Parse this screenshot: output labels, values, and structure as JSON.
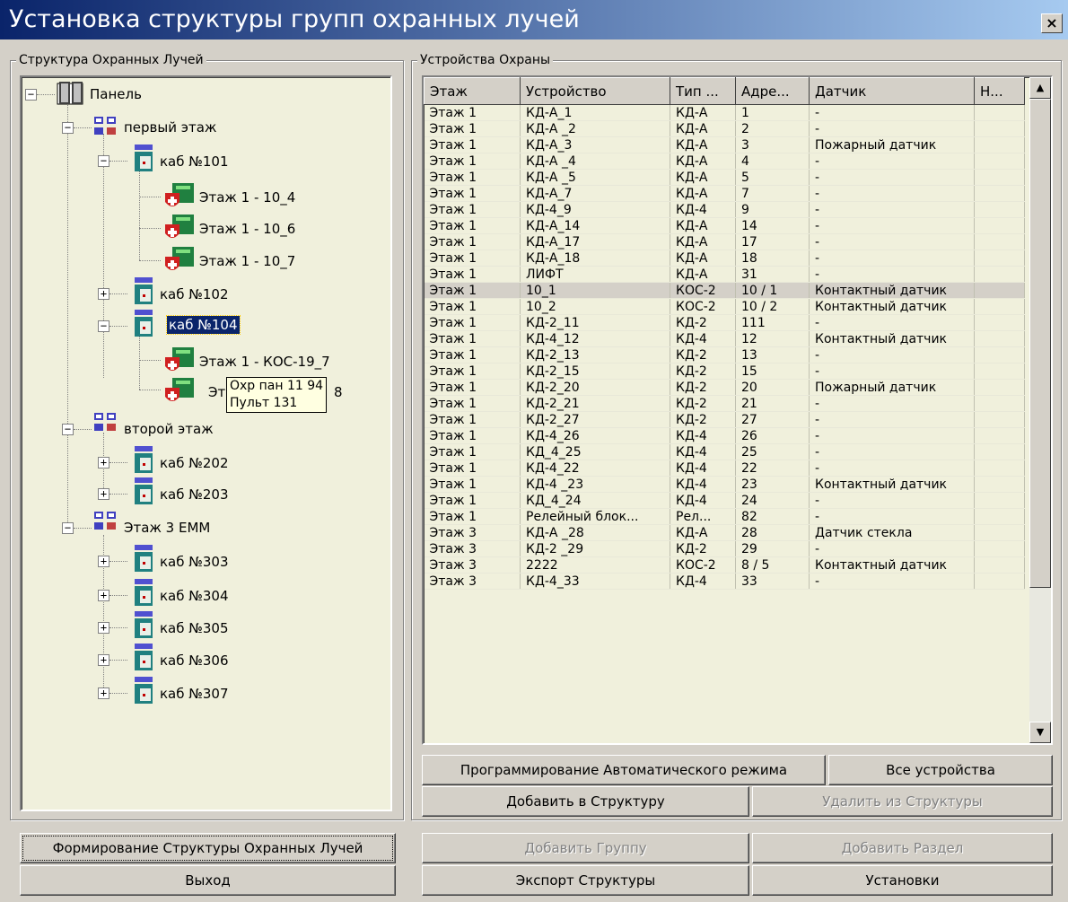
{
  "window": {
    "title": "Установка структуры групп охранных лучей",
    "close": "×"
  },
  "left_group": {
    "label": "Структура Охранных Лучей"
  },
  "right_group": {
    "label": "Устройства Охраны"
  },
  "tree": {
    "root": "Панель",
    "floor1": "первый этаж",
    "room101": "каб №101",
    "z1": "Этаж 1 - 10_4",
    "z2": "Этаж 1 - 10_6",
    "z3": "Этаж 1 - 10_7",
    "room102": "каб №102",
    "room104": "каб №104",
    "z4": "Этаж 1 - КОС-19_7",
    "z5a": "Эт",
    "z5b": "8",
    "floor2": "второй этаж",
    "room202": "каб №202",
    "room203": "каб №203",
    "floor3": "Этаж 3  ЕММ",
    "room303": "каб №303",
    "room304": "каб №304",
    "room305": "каб №305",
    "room306": "каб №306",
    "room307": "каб №307"
  },
  "tooltip": {
    "line1": "Охр пан 11 94",
    "line2": "Пульт 131"
  },
  "table": {
    "headers": [
      "Этаж",
      "Устройство",
      "Тип ...",
      "Адре...",
      "Датчик",
      "Н..."
    ],
    "rows": [
      [
        "Этаж 1",
        "КД-А_1",
        "КД-А",
        "1",
        "-",
        ""
      ],
      [
        "Этаж 1",
        "КД-А _2",
        "КД-А",
        "2",
        "-",
        ""
      ],
      [
        "Этаж 1",
        "КД-А_3",
        "КД-А",
        "3",
        "Пожарный датчик",
        ""
      ],
      [
        "Этаж 1",
        "КД-А _4",
        "КД-А",
        "4",
        "-",
        ""
      ],
      [
        "Этаж 1",
        "КД-А _5",
        "КД-А",
        "5",
        "-",
        ""
      ],
      [
        "Этаж 1",
        "КД-А_7",
        "КД-А",
        "7",
        "-",
        ""
      ],
      [
        "Этаж 1",
        "КД-4_9",
        "КД-4",
        "9",
        "-",
        ""
      ],
      [
        "Этаж 1",
        "КД-А_14",
        "КД-А",
        "14",
        "-",
        ""
      ],
      [
        "Этаж 1",
        "КД-А_17",
        "КД-А",
        "17",
        "-",
        ""
      ],
      [
        "Этаж 1",
        "КД-А_18",
        "КД-А",
        "18",
        "-",
        ""
      ],
      [
        "Этаж 1",
        "ЛИФТ",
        "КД-А",
        "31",
        "-",
        ""
      ],
      [
        "Этаж 1",
        "10_1",
        "КОС-2",
        "10 / 1",
        "Контактный датчик",
        ""
      ],
      [
        "Этаж 1",
        "10_2",
        "КОС-2",
        "10 / 2",
        "Контактный датчик",
        ""
      ],
      [
        "Этаж 1",
        "КД-2_11",
        "КД-2",
        "111",
        "-",
        ""
      ],
      [
        "Этаж 1",
        "КД-4_12",
        "КД-4",
        "12",
        "Контактный датчик",
        ""
      ],
      [
        "Этаж 1",
        "КД-2_13",
        "КД-2",
        "13",
        "-",
        ""
      ],
      [
        "Этаж 1",
        "КД-2_15",
        "КД-2",
        "15",
        "-",
        ""
      ],
      [
        "Этаж 1",
        "КД-2_20",
        "КД-2",
        "20",
        "Пожарный датчик",
        ""
      ],
      [
        "Этаж 1",
        "КД-2_21",
        "КД-2",
        "21",
        "-",
        ""
      ],
      [
        "Этаж 1",
        "КД-2_27",
        "КД-2",
        "27",
        "-",
        ""
      ],
      [
        "Этаж 1",
        "КД-4_26",
        "КД-4",
        "26",
        "-",
        ""
      ],
      [
        "Этаж 1",
        "КД_4_25",
        "КД-4",
        "25",
        "-",
        ""
      ],
      [
        "Этаж 1",
        "КД-4_22",
        "КД-4",
        "22",
        "-",
        ""
      ],
      [
        "Этаж 1",
        "КД-4 _23",
        "КД-4",
        "23",
        "Контактный датчик",
        ""
      ],
      [
        "Этаж 1",
        "КД_4_24",
        "КД-4",
        "24",
        "-",
        ""
      ],
      [
        "Этаж 1",
        "Релейный блок...",
        "Рел...",
        "82",
        "-",
        ""
      ],
      [
        "Этаж 3",
        "КД-А _28",
        "КД-А",
        "28",
        "Датчик стекла",
        ""
      ],
      [
        "Этаж 3",
        "КД-2 _29",
        "КД-2",
        "29",
        "-",
        ""
      ],
      [
        "Этаж 3",
        "2222",
        "КОС-2",
        "8 / 5",
        "Контактный датчик",
        ""
      ],
      [
        "Этаж 3",
        "КД-4_33",
        "КД-4",
        "33",
        "-",
        ""
      ]
    ],
    "highlighted_row": 11
  },
  "buttons": {
    "prog_auto": "Программирование Автоматического режима",
    "all_devices": "Все устройства",
    "add_to_struct": "Добавить в Структуру",
    "remove_from_struct": "Удалить из Структуры",
    "form_struct": "Формирование Структуры Охранных Лучей",
    "exit": "Выход",
    "add_group": "Добавить Группу",
    "add_section": "Добавить Раздел",
    "export_struct": "Экспорт Структуры",
    "settings": "Установки"
  },
  "icons": {
    "panel": "book-panel-icon",
    "floor": "network-floor-icon",
    "room": "room-module-icon",
    "zone": "shield-zone-icon"
  }
}
